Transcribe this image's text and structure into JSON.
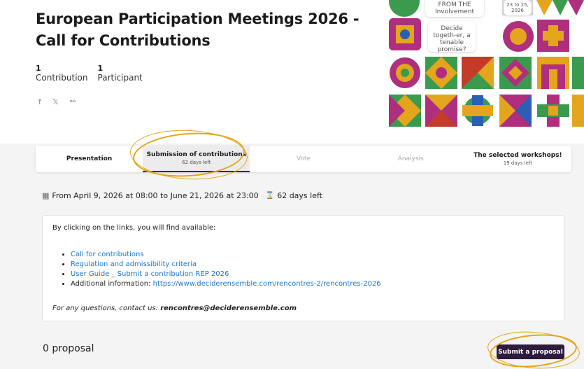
{
  "header": {
    "title": "European Participation Meetings 2026 - Call for Contributions",
    "stats": [
      {
        "count": "1",
        "label": "Contribution"
      },
      {
        "count": "1",
        "label": "Participant"
      }
    ],
    "share_icons": [
      "facebook-icon",
      "x-icon",
      "link-icon"
    ]
  },
  "artwork": {
    "card1_line1": "FROM THE",
    "card1_line2": "Involvement",
    "card2_line1": "23 to 25,",
    "card2_line2": "2026",
    "card3": "Decide togeth-er, a tenable promise?"
  },
  "tabs": [
    {
      "label": "Presentation",
      "sub": ""
    },
    {
      "label": "Submission of contributions",
      "sub": "62 days left"
    },
    {
      "label": "Vote",
      "sub": ""
    },
    {
      "label": "Analysis",
      "sub": ""
    },
    {
      "label": "The selected workshops!",
      "sub": "19 days left"
    }
  ],
  "dates": {
    "range": "From April 9, 2026 at 08:00 to June 21, 2026 at 23:00",
    "remaining": "62 days left"
  },
  "info": {
    "intro": "By clicking on the links, you will find available:",
    "links": [
      "Call for contributions",
      "Regulation and admissibility criteria",
      "User Guide _ Submit a contribution REP 2026"
    ],
    "additional_label": "Additional information: ",
    "additional_url": "https://www.deciderensemble.com/rencontres-2/rencontres-2026",
    "contact_label": "For any questions, contact us: ",
    "contact_email": "rencontres@deciderensemble.com"
  },
  "footer": {
    "proposal_count": "0 proposal",
    "submit_label": "Submit a proposal"
  },
  "colors": {
    "accent": "#2d1a3d",
    "link": "#1e78c8",
    "highlight": "#e3a51b"
  }
}
